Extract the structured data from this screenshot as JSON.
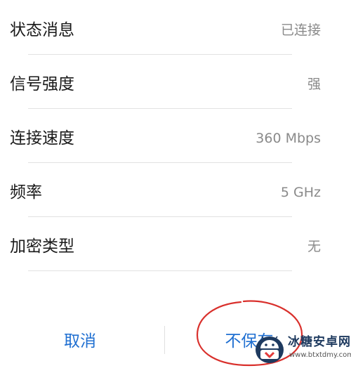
{
  "wifi_details": {
    "rows": [
      {
        "label": "状态消息",
        "value": "已连接"
      },
      {
        "label": "信号强度",
        "value": "强"
      },
      {
        "label": "连接速度",
        "value": "360 Mbps"
      },
      {
        "label": "频率",
        "value": "5 GHz"
      },
      {
        "label": "加密类型",
        "value": "无"
      }
    ]
  },
  "dialog_buttons": {
    "cancel_label": "取消",
    "forget_label": "不保存"
  },
  "annotation": {
    "highlight_color": "#d9302c",
    "target": "forget-button"
  },
  "watermark": {
    "title": "冰糖安卓网",
    "url": "www.btxtdmy.com",
    "logo_icon": "android-logo-icon"
  },
  "colors": {
    "accent": "#1f6fd1",
    "label_text": "#1a1a1a",
    "value_text": "#8a8a8a"
  }
}
